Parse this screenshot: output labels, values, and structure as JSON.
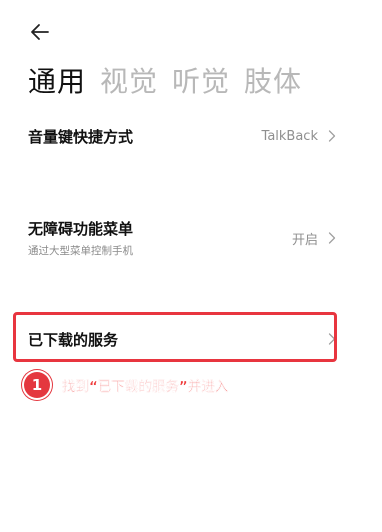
{
  "header": {
    "back_icon": "arrow-left-icon"
  },
  "tabs": [
    {
      "label": "通用",
      "active": true
    },
    {
      "label": "视觉",
      "active": false
    },
    {
      "label": "听觉",
      "active": false
    },
    {
      "label": "肢体",
      "active": false
    }
  ],
  "settings": {
    "shortcut": {
      "title": "音量键快捷方式",
      "value": "TalkBack"
    },
    "menu": {
      "title": "无障碍功能菜单",
      "subtitle": "通过大型菜单控制手机",
      "value": "开启"
    },
    "downloaded": {
      "title": "已下载的服务"
    }
  },
  "annotation": {
    "step_number": "1",
    "text": "找到“已下载的服务”并进入",
    "color": "#e4373f"
  }
}
